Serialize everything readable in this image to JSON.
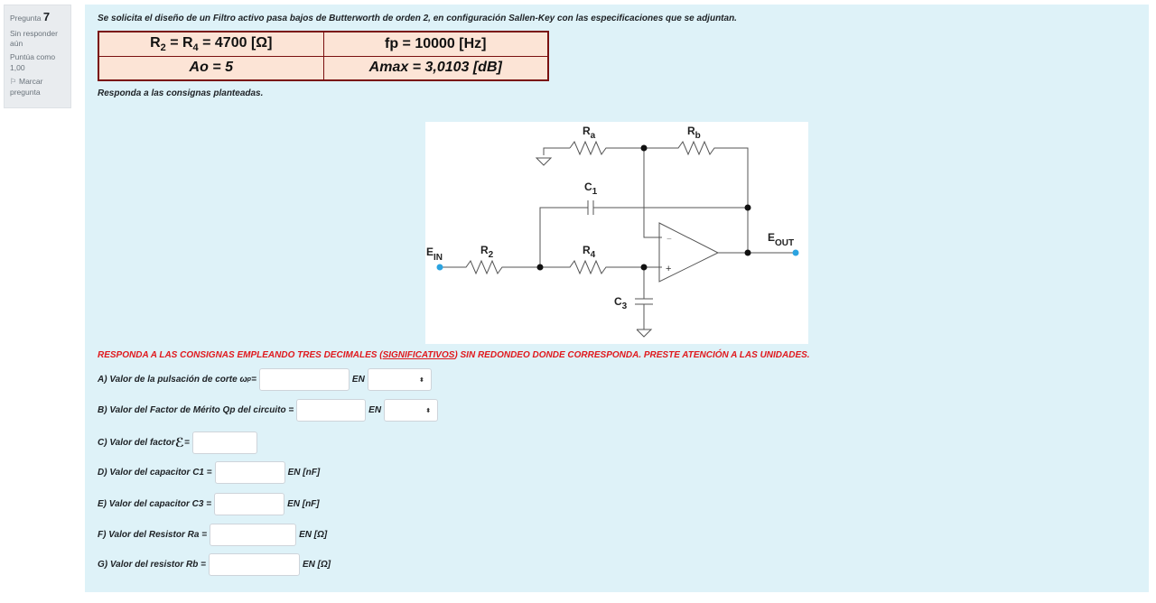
{
  "info": {
    "question_label": "Pregunta",
    "question_number": "7",
    "status": "Sin responder aún",
    "grade": "Puntúa como 1,00",
    "flag": "Marcar pregunta"
  },
  "question": {
    "intro": "Se solicita el diseño de un Filtro activo pasa bajos de Butterworth de orden 2, en configuración Sallen-Key con las especificaciones que se adjuntan.",
    "spec": {
      "r_eq_pre": "R",
      "r2_sub": "2",
      "r_eq_mid": " = R",
      "r4_sub": "4",
      "r_eq_post": " = 4700 [Ω]",
      "fp": "fp = 10000 [Hz]",
      "ao": "Ao = 5",
      "amax": "Amax = 3,0103 [dB]"
    },
    "consignas": "Responda a las consignas planteadas.",
    "warning_pre": "RESPONDA A LAS CONSIGNAS EMPLEANDO TRES DECIMALES (",
    "warning_u": "SIGNIFICATIVOS",
    "warning_post": ") SIN REDONDEO DONDE CORRESPONDA. PRESTE ATENCIÓN A LAS UNIDADES."
  },
  "circuit": {
    "ra": "a",
    "rb": "b",
    "c1": "1",
    "c3": "3",
    "r2": "2",
    "r4": "4",
    "ein": "IN",
    "eout": "OUT",
    "r": "R",
    "c": "C",
    "e": "E",
    "minus": "−",
    "plus": "+"
  },
  "answers": [
    {
      "id": "A",
      "pre": "A) Valor de la pulsación de corte ω",
      "sub": "p",
      "post": " =",
      "unit": "EN",
      "select": true
    },
    {
      "id": "B",
      "pre": "B) Valor del Factor de Mérito Qp del circuito =",
      "sub": "",
      "post": "",
      "unit": "EN",
      "select": true
    },
    {
      "id": "C",
      "pre": "C) Valor del factor ",
      "sub": "",
      "post": " =",
      "symbol": "ℰ",
      "unit": "",
      "select": false
    },
    {
      "id": "D",
      "pre": "D) Valor del capacitor C1 =",
      "sub": "",
      "post": "",
      "unit": "EN [nF]",
      "select": false
    },
    {
      "id": "E",
      "pre": "E) Valor del capacitor C3 =",
      "sub": "",
      "post": "",
      "unit": "EN [nF]",
      "select": false
    },
    {
      "id": "F",
      "pre": "F) Valor del Resistor Ra  =",
      "sub": "",
      "post": "",
      "unit": "EN [Ω]",
      "select": false
    },
    {
      "id": "G",
      "pre": "G) Valor del resistor Rb  =",
      "sub": "",
      "post": "",
      "unit": "EN [Ω]",
      "select": false
    }
  ],
  "select_glyph": "⬍"
}
